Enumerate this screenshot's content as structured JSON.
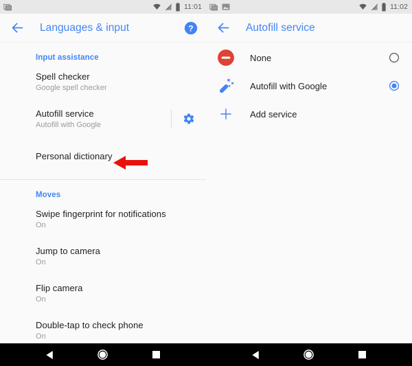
{
  "left_screen": {
    "status_bar": {
      "time": "11:01",
      "notification_icons": [
        "screenshot-icon"
      ],
      "system_icons": [
        "wifi-icon",
        "cellular-signal-off-icon",
        "battery-icon"
      ]
    },
    "app_bar": {
      "back_icon": "back-arrow-icon",
      "title": "Languages & input",
      "help_icon": "help-icon"
    },
    "sections": [
      {
        "header": "Input assistance",
        "items": [
          {
            "title": "Spell checker",
            "subtitle": "Google spell checker",
            "has_settings": false
          },
          {
            "title": "Autofill service",
            "subtitle": "Autofill with Google",
            "has_settings": true,
            "settings_icon": "gear-icon"
          },
          {
            "title": "Personal dictionary",
            "subtitle": "",
            "has_settings": false
          }
        ]
      },
      {
        "header": "Moves",
        "items": [
          {
            "title": "Swipe fingerprint for notifications",
            "subtitle": "On",
            "has_settings": false
          },
          {
            "title": "Jump to camera",
            "subtitle": "On",
            "has_settings": false
          },
          {
            "title": "Flip camera",
            "subtitle": "On",
            "has_settings": false
          },
          {
            "title": "Double-tap to check phone",
            "subtitle": "On",
            "has_settings": false
          }
        ]
      }
    ],
    "annotation": {
      "icon": "red-left-arrow",
      "color": "#e8120c"
    },
    "nav_bar": {
      "back": "back-triangle-icon",
      "home": "home-circle-icon",
      "recents": "recents-square-icon"
    }
  },
  "right_screen": {
    "status_bar": {
      "time": "11:02",
      "notification_icons": [
        "screenshot-icon",
        "image-icon"
      ],
      "system_icons": [
        "wifi-icon",
        "cellular-signal-off-icon",
        "battery-icon"
      ]
    },
    "app_bar": {
      "back_icon": "back-arrow-icon",
      "title": "Autofill service"
    },
    "options": [
      {
        "label": "None",
        "icon": "block-icon",
        "selected": false
      },
      {
        "label": "Autofill with Google",
        "icon": "magic-wand-icon",
        "selected": true
      },
      {
        "label": "Add service",
        "icon": "plus-icon",
        "selected": null
      }
    ],
    "nav_bar": {
      "back": "back-triangle-icon",
      "home": "home-circle-icon",
      "recents": "recents-square-icon"
    }
  },
  "colors": {
    "accent_blue": "#4285f4",
    "annotation_red": "#e8120c",
    "block_red": "#db4437",
    "background": "#fafafa"
  }
}
